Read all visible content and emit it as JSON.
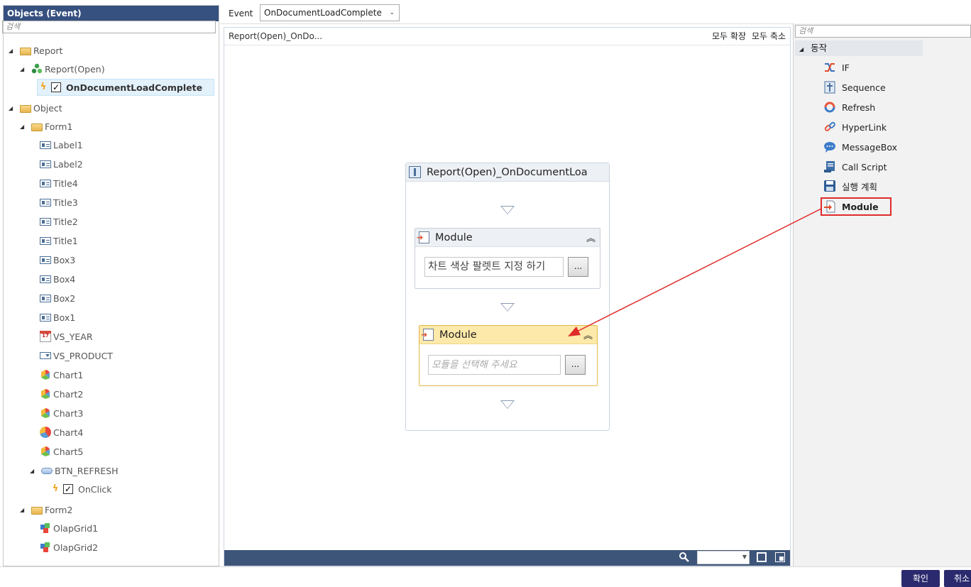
{
  "left_panel": {
    "title": "Objects (Event)",
    "search_placeholder": "검색",
    "tree": {
      "report": "Report",
      "report_open": "Report(Open)",
      "on_document_load_complete": "OnDocumentLoadComplete",
      "object": "Object",
      "form1": "Form1",
      "label1": "Label1",
      "label2": "Label2",
      "title4": "Title4",
      "title3": "Title3",
      "title2": "Title2",
      "title1": "Title1",
      "box3": "Box3",
      "box4": "Box4",
      "box2": "Box2",
      "box1": "Box1",
      "vs_year": "VS_YEAR",
      "vs_product": "VS_PRODUCT",
      "chart1": "Chart1",
      "chart2": "Chart2",
      "chart3": "Chart3",
      "chart4": "Chart4",
      "chart5": "Chart5",
      "btn_refresh": "BTN_REFRESH",
      "on_click": "OnClick",
      "form2": "Form2",
      "olapgrid1": "OlapGrid1",
      "olapgrid2": "OlapGrid2"
    }
  },
  "toolbar": {
    "event_label": "Event",
    "event_value": "OnDocumentLoadComplete"
  },
  "canvas": {
    "breadcrumb": "Report(Open)_OnDo...",
    "expand_all": "모두 확장",
    "collapse_all": "모두 축소",
    "sequence_title": "Report(Open)_OnDocumentLoa",
    "module1": {
      "title": "Module",
      "value": "차트 색상 팔렛트 지정 하기",
      "button": "..."
    },
    "module2": {
      "title": "Module",
      "placeholder": "모듈을 선택해 주세요",
      "button": "..."
    },
    "zoom_value": ""
  },
  "right_panel": {
    "search_placeholder": "검색",
    "group": "동작",
    "actions": [
      {
        "label": "IF",
        "icon": "shuffle-icon"
      },
      {
        "label": "Sequence",
        "icon": "sequence-icon"
      },
      {
        "label": "Refresh",
        "icon": "refresh-icon"
      },
      {
        "label": "HyperLink",
        "icon": "link-icon"
      },
      {
        "label": "MessageBox",
        "icon": "message-icon"
      },
      {
        "label": "Call Script",
        "icon": "script-icon"
      },
      {
        "label": "실행 계획",
        "icon": "save-icon"
      },
      {
        "label": "Module",
        "icon": "module-icon"
      }
    ]
  },
  "footer": {
    "ok": "확인",
    "cancel": "취소"
  },
  "colors": {
    "header_bg": "#36507f",
    "status_bar": "#3e557a",
    "active_module": "#fde9a9",
    "highlight": "#e02b2b",
    "button_bg": "#2b2a6e"
  }
}
